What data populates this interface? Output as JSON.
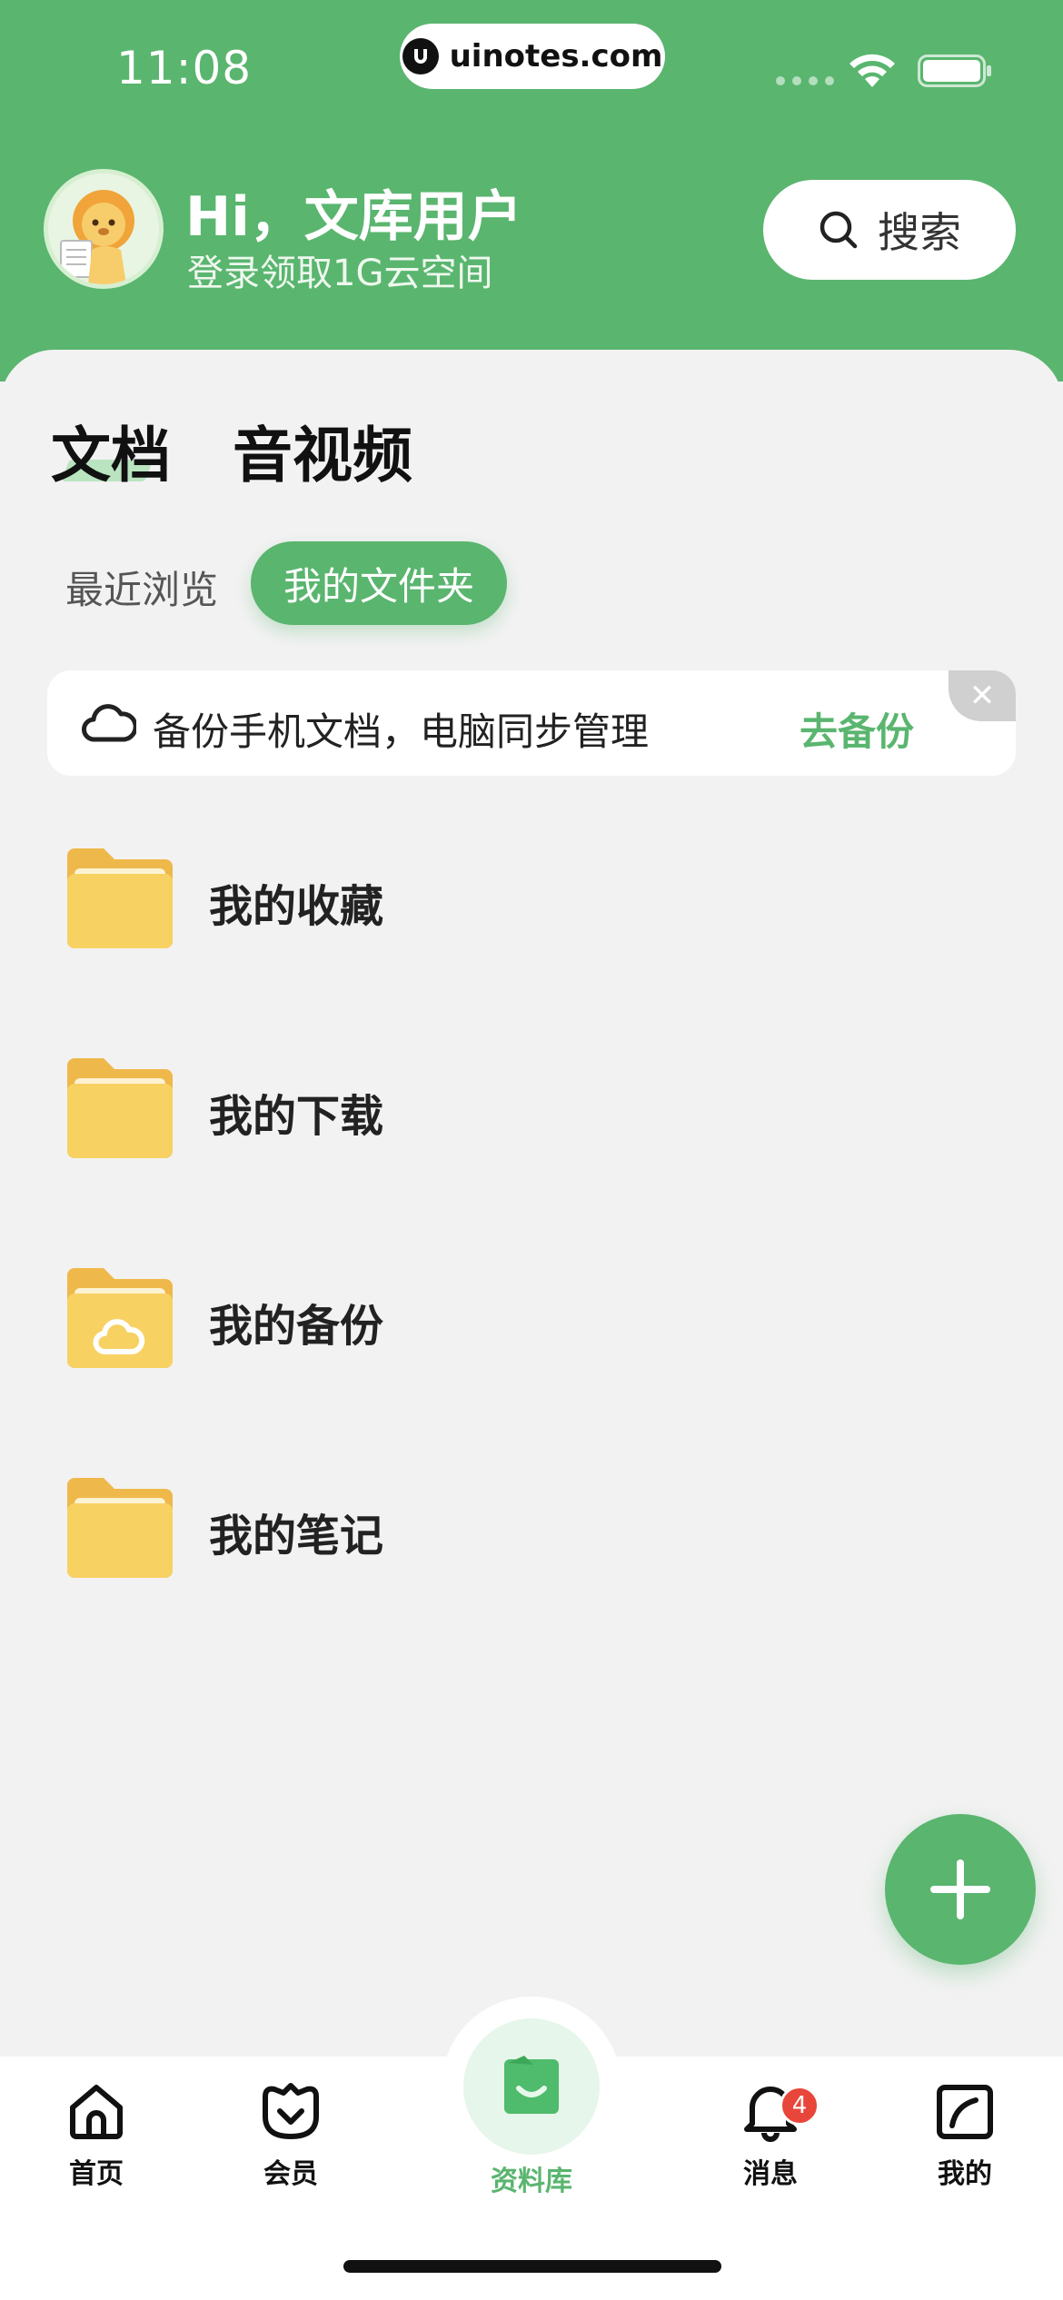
{
  "status_bar": {
    "time": "11:08",
    "url": "uinotes.com"
  },
  "header": {
    "greeting": "Hi，文库用户",
    "subtitle": "登录领取1G云空间",
    "search_label": "搜索"
  },
  "main_tabs": [
    {
      "label": "文档",
      "active": true
    },
    {
      "label": "音视频",
      "active": false
    }
  ],
  "sub_tabs": [
    {
      "label": "最近浏览",
      "active": false
    },
    {
      "label": "我的文件夹",
      "active": true
    }
  ],
  "banner": {
    "text": "备份手机文档，电脑同步管理",
    "action": "去备份"
  },
  "folders": [
    {
      "label": "我的收藏",
      "icon": "folder-icon"
    },
    {
      "label": "我的下载",
      "icon": "folder-icon"
    },
    {
      "label": "我的备份",
      "icon": "cloud-folder-icon"
    },
    {
      "label": "我的笔记",
      "icon": "folder-icon"
    }
  ],
  "bottom_nav": {
    "items": [
      {
        "label": "首页",
        "icon": "home-icon"
      },
      {
        "label": "会员",
        "icon": "vip-icon"
      },
      {
        "label": "资料库",
        "icon": "library-icon",
        "active": true
      },
      {
        "label": "消息",
        "icon": "bell-icon",
        "badge": "4"
      },
      {
        "label": "我的",
        "icon": "profile-icon"
      }
    ]
  },
  "colors": {
    "brand_green": "#5ab56f",
    "folder_yellow": "#f8cf5a",
    "badge_red": "#e8463a"
  }
}
